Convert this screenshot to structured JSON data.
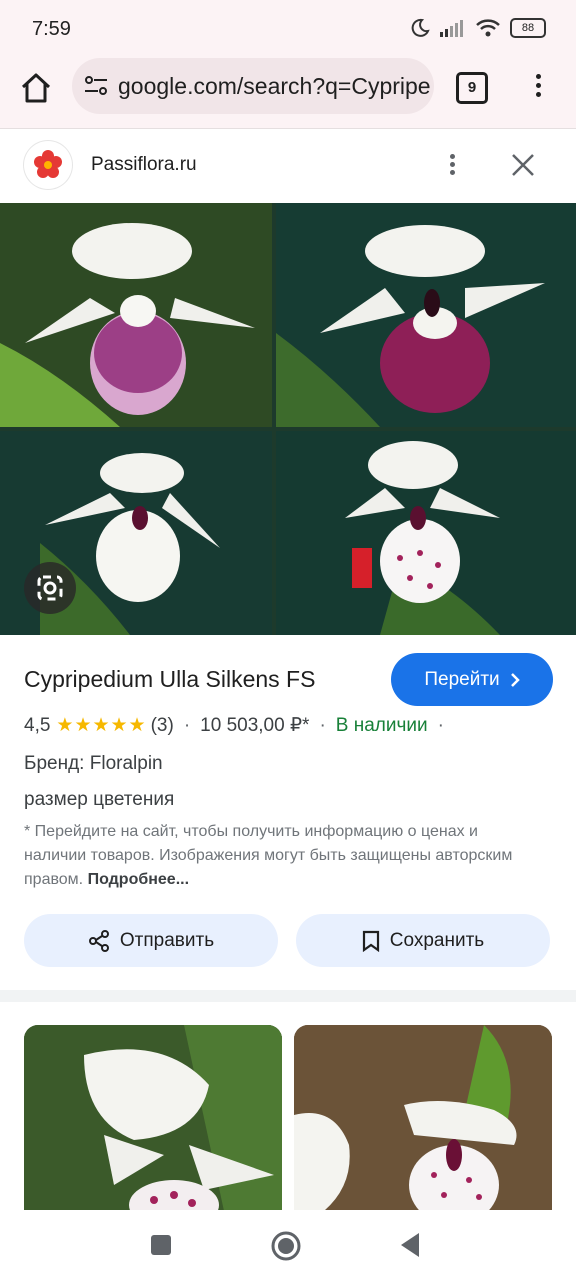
{
  "status": {
    "time": "7:59",
    "battery": "88"
  },
  "browser": {
    "url": "google.com/search?q=Cypripe",
    "tab_count": "9"
  },
  "source": {
    "name": "Passiflora.ru"
  },
  "product": {
    "title": "Cypripedium Ulla Silkens FS",
    "go_label": "Перейти",
    "rating_value": "4,5",
    "stars": "★★★★★",
    "review_count": "(3)",
    "price": "10 503,00 ₽*",
    "availability": "В наличии",
    "brand": "Бренд: Floralpin",
    "extra": "размер цветения",
    "disclaimer": "* Перейдите на сайт, чтобы получить информацию о ценах и наличии товаров. Изображения могут быть защищены авторским правом.",
    "more_link": "Подробнее..."
  },
  "actions": {
    "share_label": "Отправить",
    "save_label": "Сохранить"
  },
  "colors": {
    "accent": "#1a73e8",
    "stock_green": "#188038",
    "star": "#f6b800"
  }
}
